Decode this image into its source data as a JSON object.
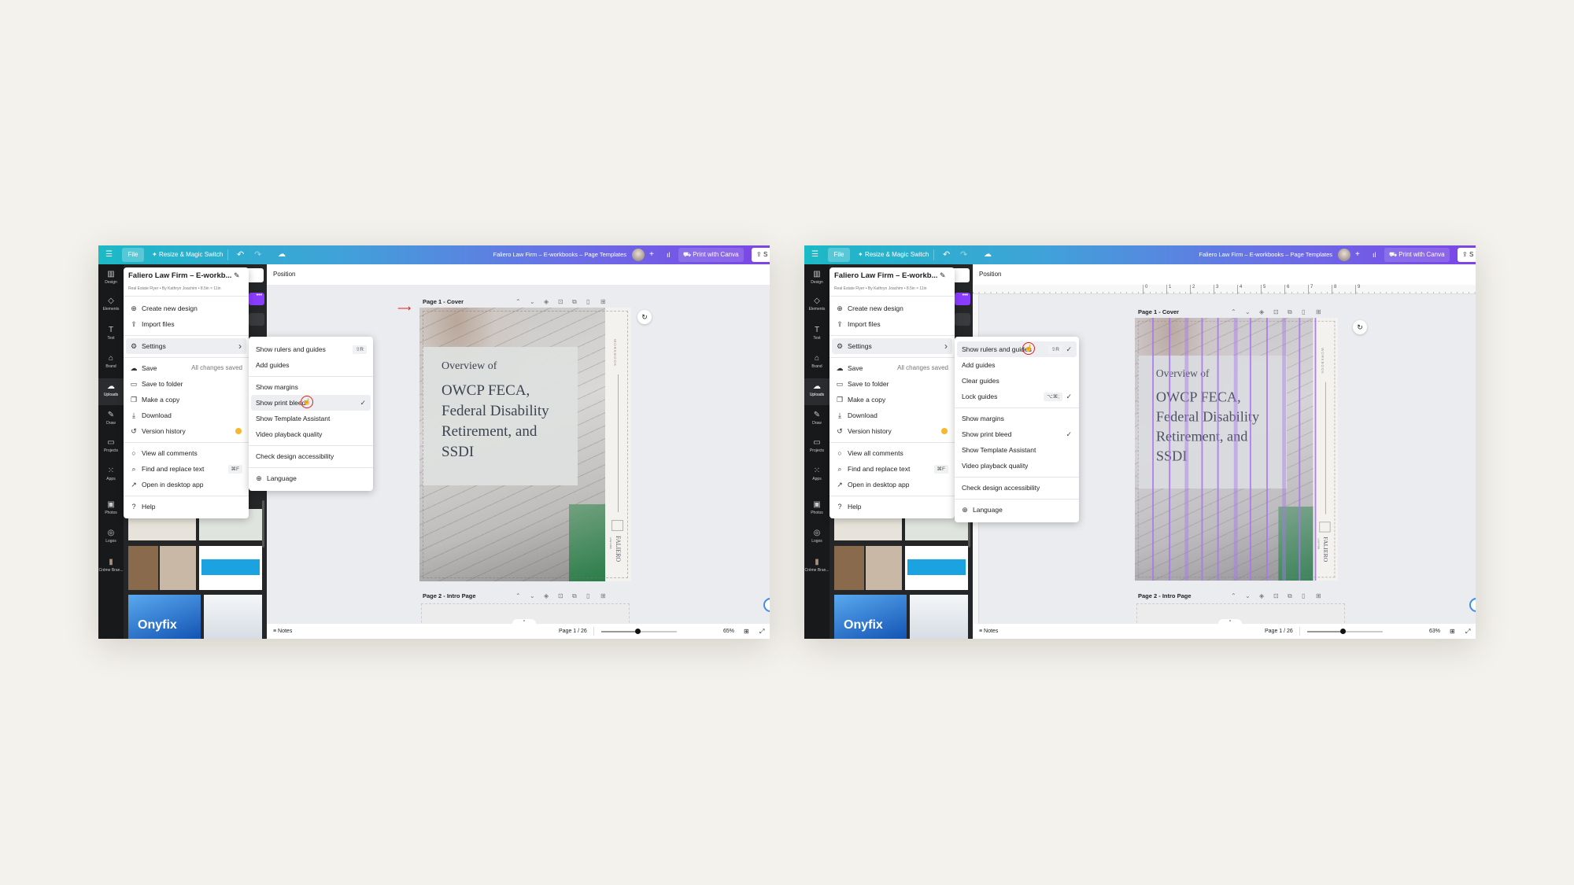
{
  "page": {
    "background": "#f4f2ed"
  },
  "colors": {
    "accent_purple": "#7d2ae8",
    "topbar_start": "#1cb9c6",
    "topbar_end": "#7b45e6",
    "annotation_red": "#e02020",
    "guide_purple": "#a56cf0"
  },
  "editor": {
    "topbar": {
      "menu_icon": "hamburger-icon",
      "file": "File",
      "resize": "Resize & Magic Switch",
      "title": "Faliero Law Firm – E-workbooks – Page Templates",
      "print": "Print with Canva",
      "share": "S"
    },
    "rail": [
      {
        "label": "Design",
        "icon": "layout-icon"
      },
      {
        "label": "Elements",
        "icon": "shapes-icon"
      },
      {
        "label": "Text",
        "icon": "text-icon"
      },
      {
        "label": "Brand",
        "icon": "brand-icon"
      },
      {
        "label": "Uploads",
        "icon": "upload-cloud-icon",
        "active": true
      },
      {
        "label": "Draw",
        "icon": "pen-icon"
      },
      {
        "label": "Projects",
        "icon": "folder-icon"
      },
      {
        "label": "Apps",
        "icon": "apps-grid-icon"
      },
      {
        "label": "Photos",
        "icon": "image-icon"
      },
      {
        "label": "Logos",
        "icon": "logo-icon"
      },
      {
        "label": "Créme Bran...",
        "icon": "brand-kit-thumbnail"
      }
    ],
    "uploads_logo_text": "Onyfix",
    "position_label": "Position",
    "file_menu": {
      "title": "Faliero Law Firm – E-workb...",
      "subtitle": "Real Estate Flyer • By Kathryn Joachim • 8.5in × 11in",
      "groups": [
        [
          {
            "label": "Create new design",
            "icon": "plus-doc-icon"
          },
          {
            "label": "Import files",
            "icon": "import-icon"
          }
        ],
        [
          {
            "label": "Settings",
            "icon": "gear-icon",
            "submenu": true,
            "selected": true
          }
        ],
        [
          {
            "label": "Save",
            "icon": "cloud-check-icon",
            "hint": "All changes saved"
          },
          {
            "label": "Save to folder",
            "icon": "folder-icon"
          },
          {
            "label": "Make a copy",
            "icon": "copy-icon"
          },
          {
            "label": "Download",
            "icon": "download-icon"
          },
          {
            "label": "Version history",
            "icon": "history-icon",
            "badge": "crown-icon"
          }
        ],
        [
          {
            "label": "View all comments",
            "icon": "comment-icon"
          },
          {
            "label": "Find and replace text",
            "icon": "search-icon",
            "shortcut": "⌘F"
          },
          {
            "label": "Open in desktop app",
            "icon": "external-icon"
          }
        ],
        [
          {
            "label": "Help",
            "icon": "help-icon"
          }
        ]
      ]
    },
    "pages": [
      "Page 1 - Cover",
      "Page 2 - Intro Page"
    ],
    "cover": {
      "overview": "Overview of",
      "heading": [
        "OWCP FECA,",
        "Federal Disability",
        "Retirement, and",
        "SSDI"
      ],
      "side_label": "WORKBOOK",
      "brand": "FALIERO",
      "brand_sub": "LAW FIRM"
    },
    "bottom": {
      "notes": "Notes",
      "page_indicator": "Page 1 / 26"
    }
  },
  "panels": [
    {
      "zoom": "65%",
      "zoom_slider_fraction": 0.48,
      "rulers_visible": false,
      "guides_visible": false,
      "print_bleed_arrow": true,
      "submenu": [
        [
          {
            "label": "Show rulers and guides",
            "shortcut": "⇧R"
          },
          {
            "label": "Add guides"
          }
        ],
        [
          {
            "label": "Show margins"
          },
          {
            "label": "Show print bleed",
            "checked": true,
            "selected": true,
            "cursor": true
          },
          {
            "label": "Show Template Assistant"
          },
          {
            "label": "Video playback quality"
          }
        ],
        [
          {
            "label": "Check design accessibility"
          }
        ],
        [
          {
            "label": "Language",
            "icon": "globe-icon"
          }
        ]
      ]
    },
    {
      "zoom": "63%",
      "zoom_slider_fraction": 0.47,
      "rulers_visible": true,
      "ruler_labels": [
        "0",
        "1",
        "2",
        "3",
        "4",
        "5",
        "6",
        "7",
        "8",
        "9"
      ],
      "guides_visible": true,
      "print_bleed_arrow": false,
      "submenu": [
        [
          {
            "label": "Show rulers and guides",
            "shortcut": "⇧R",
            "checked": true,
            "selected": true,
            "cursor": true
          },
          {
            "label": "Add guides"
          },
          {
            "label": "Clear guides"
          },
          {
            "label": "Lock guides",
            "shortcut": "⌥⌘;",
            "checked": true
          }
        ],
        [
          {
            "label": "Show margins"
          },
          {
            "label": "Show print bleed",
            "checked": true
          },
          {
            "label": "Show Template Assistant"
          },
          {
            "label": "Video playback quality"
          }
        ],
        [
          {
            "label": "Check design accessibility"
          }
        ],
        [
          {
            "label": "Language",
            "icon": "globe-icon"
          }
        ]
      ]
    }
  ]
}
